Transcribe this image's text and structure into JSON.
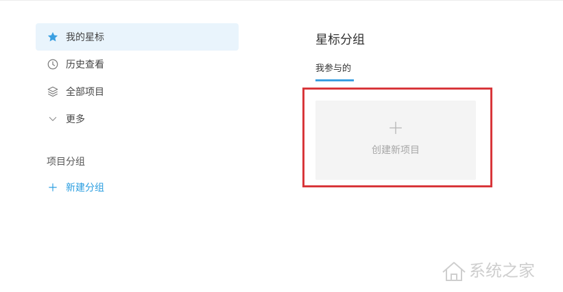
{
  "sidebar": {
    "items": [
      {
        "label": "我的星标",
        "icon": "star-icon",
        "active": true
      },
      {
        "label": "历史查看",
        "icon": "clock-icon",
        "active": false
      },
      {
        "label": "全部项目",
        "icon": "layers-icon",
        "active": false
      },
      {
        "label": "更多",
        "icon": "chevron-down-icon",
        "active": false
      }
    ],
    "section_title": "项目分组",
    "new_group_label": "新建分组"
  },
  "main": {
    "title": "星标分组",
    "tabs": [
      {
        "label": "我参与的",
        "active": true
      }
    ],
    "create_card": {
      "label": "创建新项目",
      "icon": "plus-icon"
    }
  },
  "watermark": {
    "text": "系统之家",
    "icon": "house-logo-icon"
  },
  "colors": {
    "accent": "#3a9fe1",
    "active_bg": "#e9f4fc",
    "highlight_border": "#d8363a",
    "card_bg": "#f4f4f4",
    "muted_text": "#a6a6a6"
  }
}
